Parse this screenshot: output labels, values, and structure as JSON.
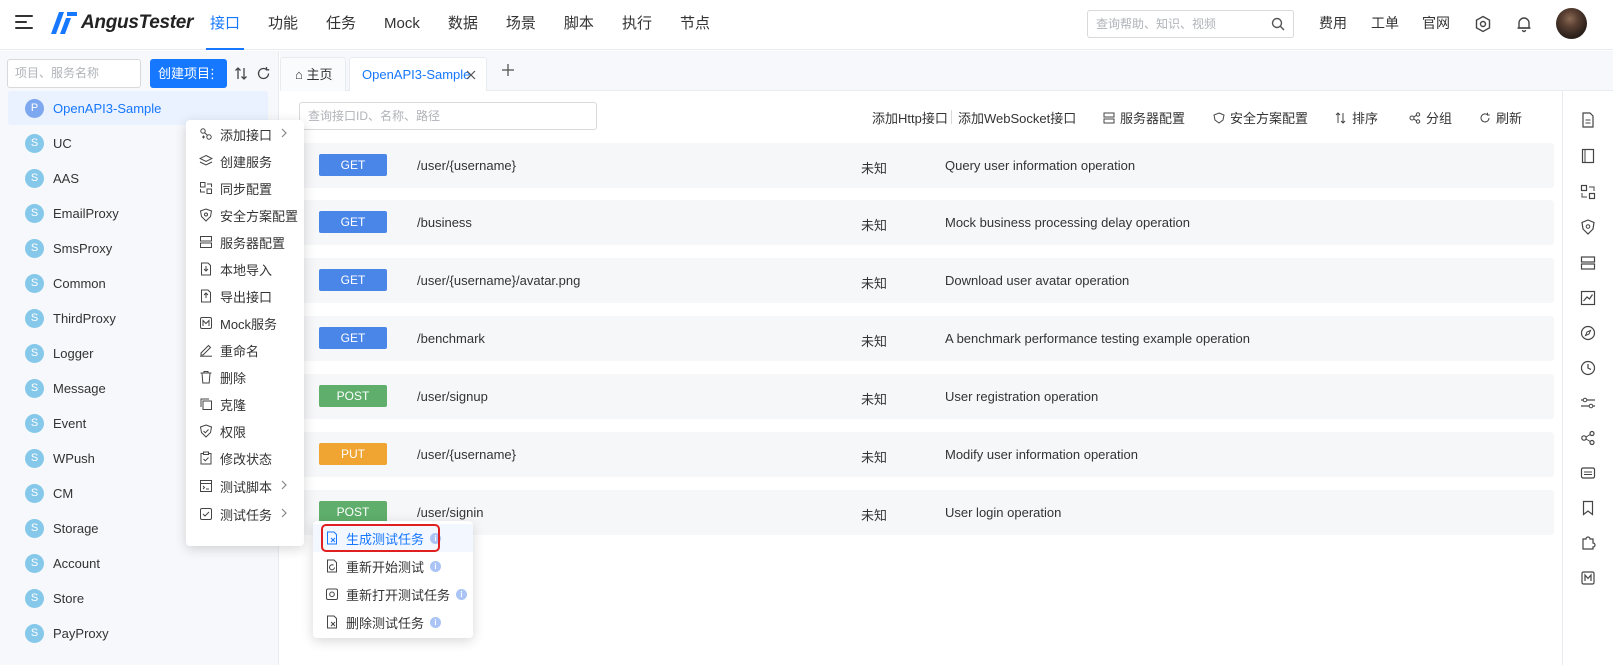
{
  "header": {
    "app_name": "AngusTester",
    "nav": [
      "接口",
      "功能",
      "任务",
      "Mock",
      "数据",
      "场景",
      "脚本",
      "执行",
      "节点"
    ],
    "active_nav": "接口",
    "search_placeholder": "查询帮助、知识、视频",
    "links": [
      "费用",
      "工单",
      "官网"
    ]
  },
  "sidebar": {
    "search_placeholder": "项目、服务名称",
    "create_button": "创建项目",
    "projects": [
      {
        "badge": "P",
        "name": "OpenAPI3-Sample"
      },
      {
        "badge": "S",
        "name": "UC"
      },
      {
        "badge": "S",
        "name": "AAS"
      },
      {
        "badge": "S",
        "name": "EmailProxy"
      },
      {
        "badge": "S",
        "name": "SmsProxy"
      },
      {
        "badge": "S",
        "name": "Common"
      },
      {
        "badge": "S",
        "name": "ThirdProxy"
      },
      {
        "badge": "S",
        "name": "Logger"
      },
      {
        "badge": "S",
        "name": "Message"
      },
      {
        "badge": "S",
        "name": "Event"
      },
      {
        "badge": "S",
        "name": "WPush"
      },
      {
        "badge": "S",
        "name": "CM"
      },
      {
        "badge": "S",
        "name": "Storage"
      },
      {
        "badge": "S",
        "name": "Account"
      },
      {
        "badge": "S",
        "name": "Store"
      },
      {
        "badge": "S",
        "name": "PayProxy"
      }
    ]
  },
  "tabs": {
    "home": "主页",
    "current": "OpenAPI3-Sample"
  },
  "toolbar": {
    "search_placeholder": "查询接口ID、名称、路径",
    "add_http": "添加Http接口",
    "add_ws": "添加WebSocket接口",
    "server_config": "服务器配置",
    "security_config": "安全方案配置",
    "sort": "排序",
    "group": "分组",
    "refresh": "刷新"
  },
  "apis": [
    {
      "method": "GET",
      "color": "#4a86e8",
      "path": "/user/{username}",
      "status": "未知",
      "desc": "Query user information operation"
    },
    {
      "method": "GET",
      "color": "#4a86e8",
      "path": "/business",
      "status": "未知",
      "desc": "Mock business processing delay operation"
    },
    {
      "method": "GET",
      "color": "#4a86e8",
      "path": "/user/{username}/avatar.png",
      "status": "未知",
      "desc": "Download user avatar operation"
    },
    {
      "method": "GET",
      "color": "#4a86e8",
      "path": "/benchmark",
      "status": "未知",
      "desc": "A benchmark performance testing example operation"
    },
    {
      "method": "POST",
      "color": "#5fae6b",
      "path": "/user/signup",
      "status": "未知",
      "desc": "User registration operation"
    },
    {
      "method": "PUT",
      "color": "#f0a533",
      "path": "/user/{username}",
      "status": "未知",
      "desc": "Modify user information operation"
    },
    {
      "method": "POST",
      "color": "#5fae6b",
      "path": "/user/signin",
      "status": "未知",
      "desc": "User login operation"
    }
  ],
  "context_menu": [
    {
      "label": "添加接口",
      "submenu": true
    },
    {
      "label": "创建服务"
    },
    {
      "label": "同步配置"
    },
    {
      "label": "安全方案配置"
    },
    {
      "label": "服务器配置"
    },
    {
      "label": "本地导入"
    },
    {
      "label": "导出接口"
    },
    {
      "label": "Mock服务"
    },
    {
      "label": "重命名"
    },
    {
      "label": "删除"
    },
    {
      "label": "克隆"
    },
    {
      "label": "权限"
    },
    {
      "label": "修改状态"
    },
    {
      "label": "测试脚本",
      "submenu": true
    },
    {
      "label": "测试任务",
      "submenu": true
    }
  ],
  "submenu": [
    {
      "label": "生成测试任务"
    },
    {
      "label": "重新开始测试"
    },
    {
      "label": "重新打开测试任务"
    },
    {
      "label": "删除测试任务"
    }
  ]
}
